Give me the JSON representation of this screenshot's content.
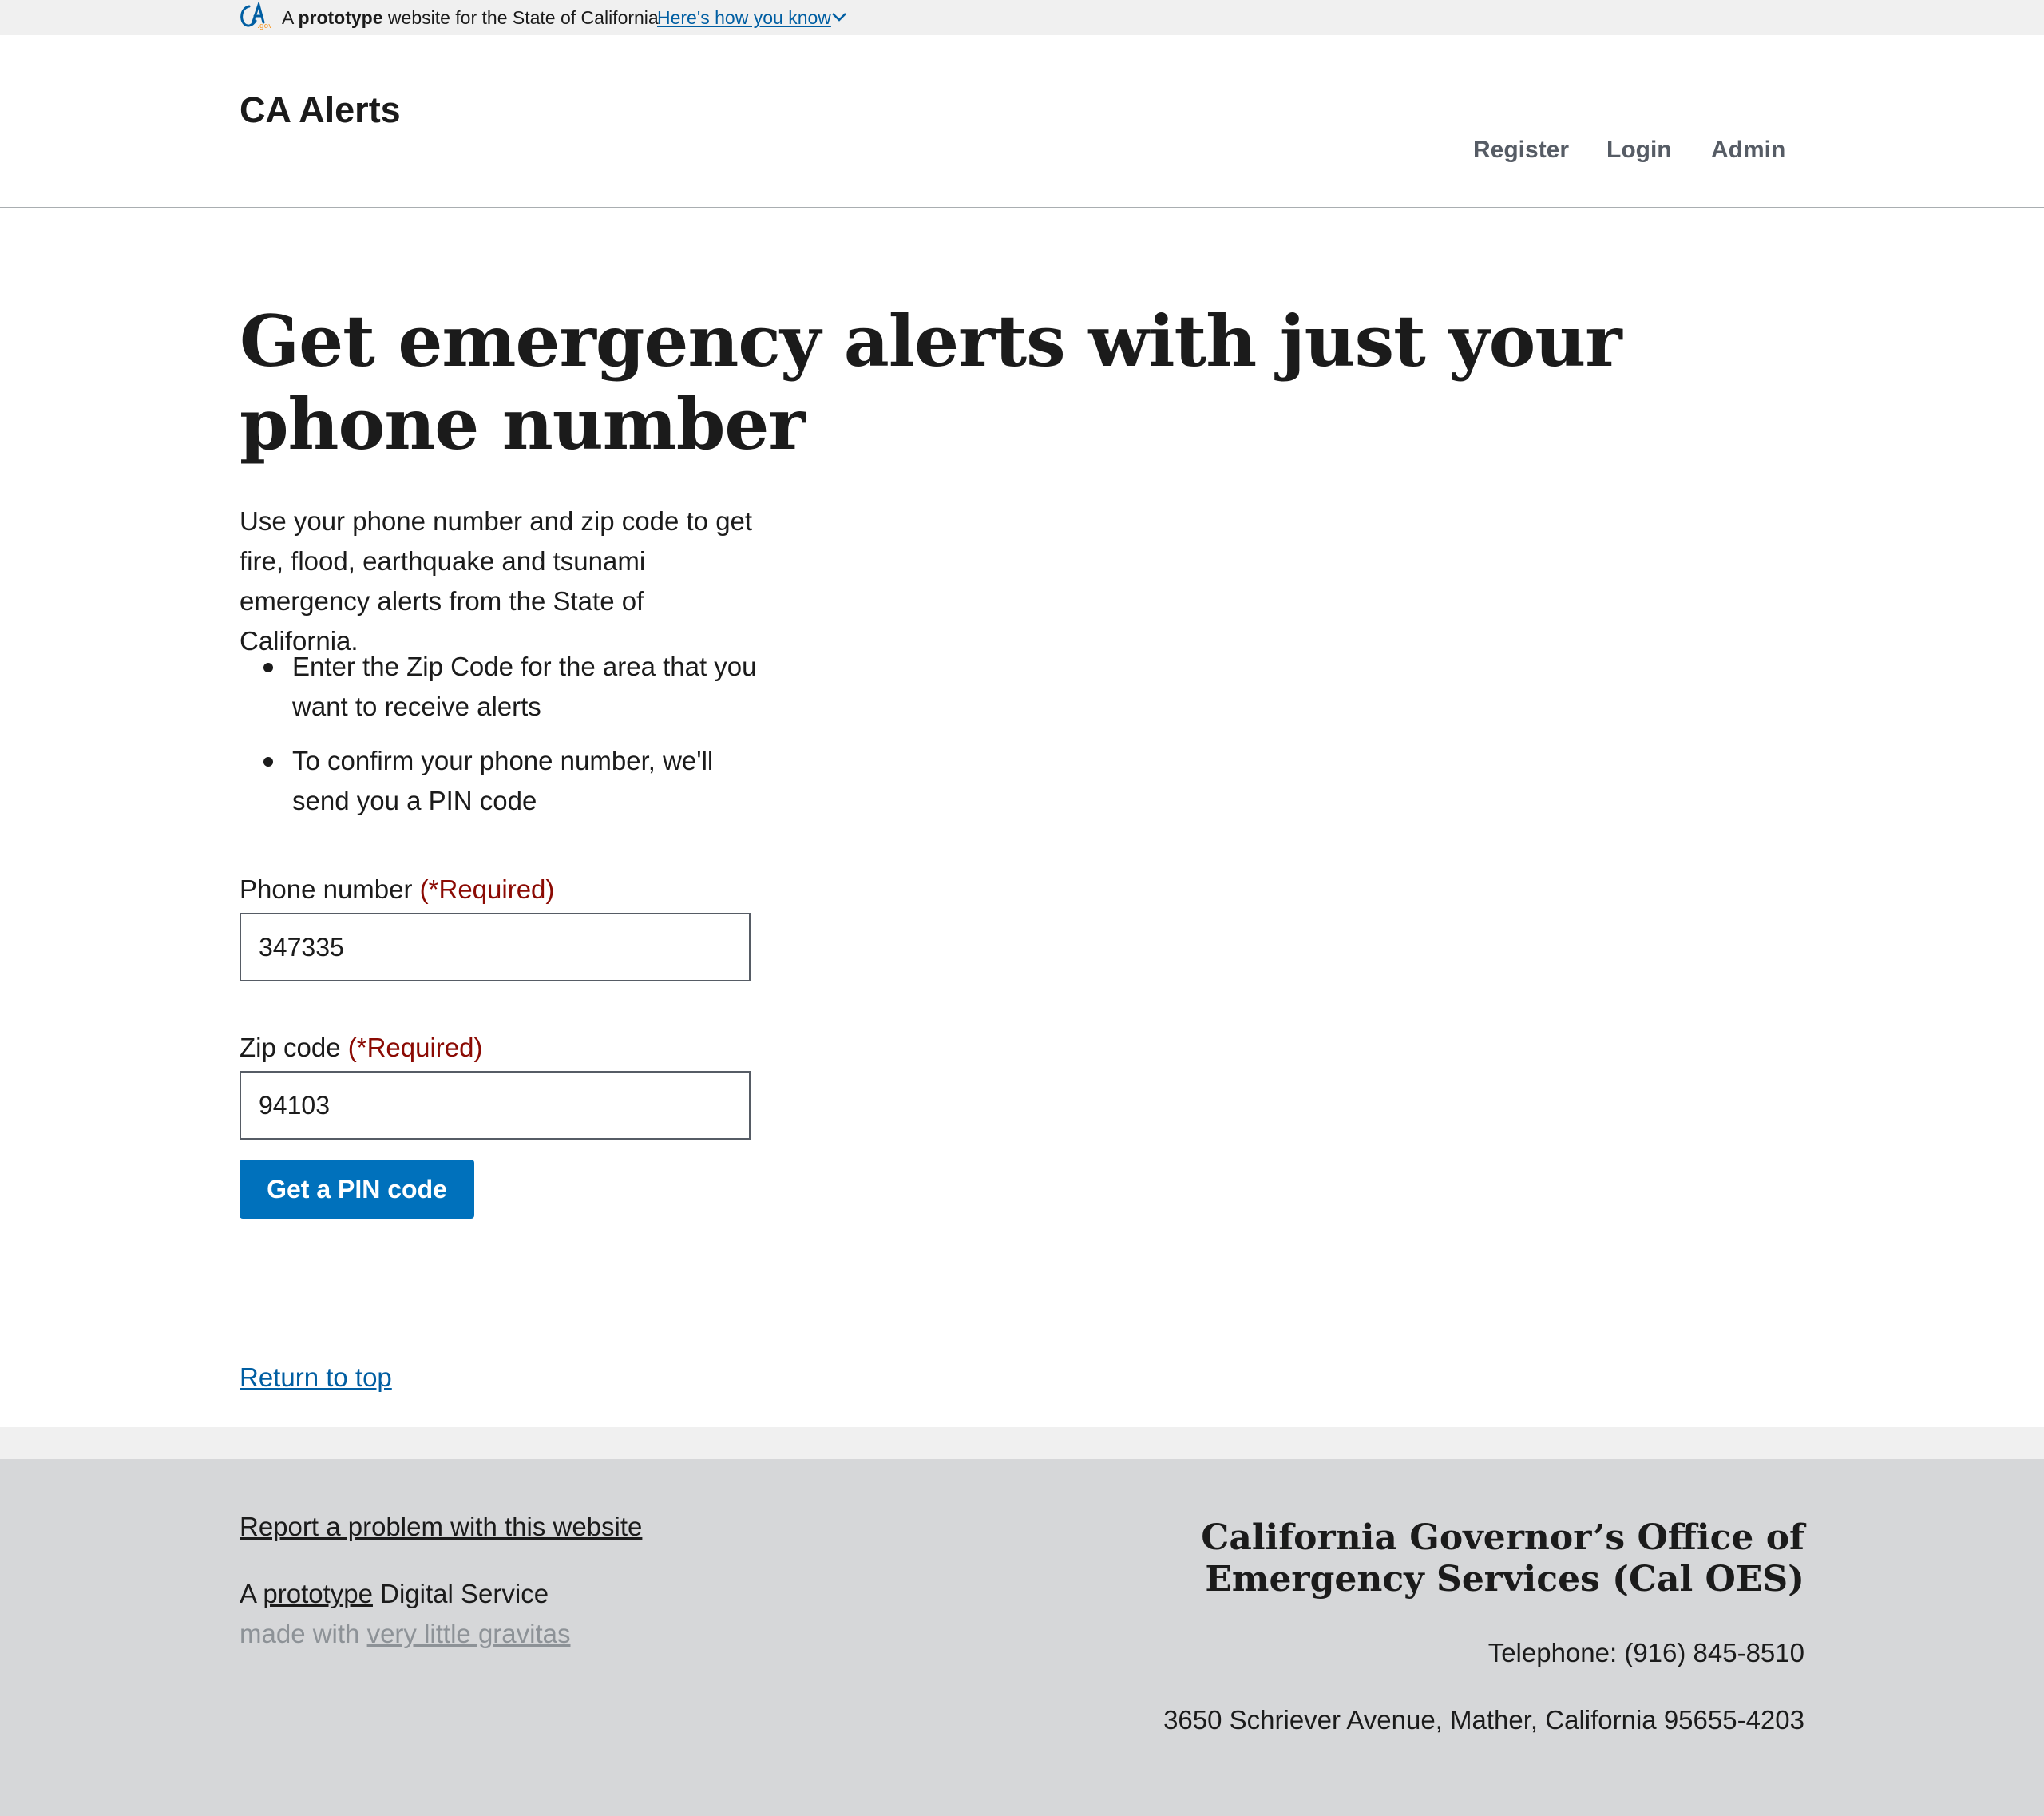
{
  "banner": {
    "logo_icon": "ca-gov-logo-icon",
    "prefix": "A",
    "bold": "prototype",
    "suffix": "website for the State of California",
    "how_link": "Here's how you know",
    "chevron_icon": "chevron-down-icon"
  },
  "header": {
    "site_title": "CA Alerts",
    "nav": [
      "Register",
      "Login",
      "Admin"
    ]
  },
  "main": {
    "title": "Get emergency alerts with just your phone number",
    "intro": "Use your phone number and zip code to get fire, flood, earthquake and tsunami emergency alerts from the State of California.",
    "bullets": [
      "Enter the Zip Code for the area that you want to receive alerts",
      "To confirm your phone number, we'll send you a PIN code"
    ],
    "phone": {
      "label": "Phone number",
      "required": "(*Required)",
      "value": "347335"
    },
    "zip": {
      "label": "Zip code",
      "required": "(*Required)",
      "value": "94103"
    },
    "submit_label": "Get a PIN code",
    "return_top": "Return to top"
  },
  "footer": {
    "report_link": "Report a problem with this website",
    "credit_a": "A",
    "credit_prototype": "prototype",
    "credit_digital": "Digital Service",
    "credit_made": "made with",
    "credit_gravitas": "very little gravitas",
    "agency_line1": "California Governor’s Office of",
    "agency_line2": "Emergency Services (Cal OES)",
    "telephone": "Telephone: (916) 845-8510",
    "address": "3650 Schriever Avenue, Mather, California 95655-4203"
  },
  "colors": {
    "primary_button": "#0071bc",
    "link": "#005ea2",
    "required": "#8b0a03",
    "banner_bg": "#f0f0f0",
    "footer_bg": "#d6d7d9",
    "nav_text": "#565c65",
    "muted_text": "#8d9297",
    "logo_orange": "#f7941d"
  }
}
